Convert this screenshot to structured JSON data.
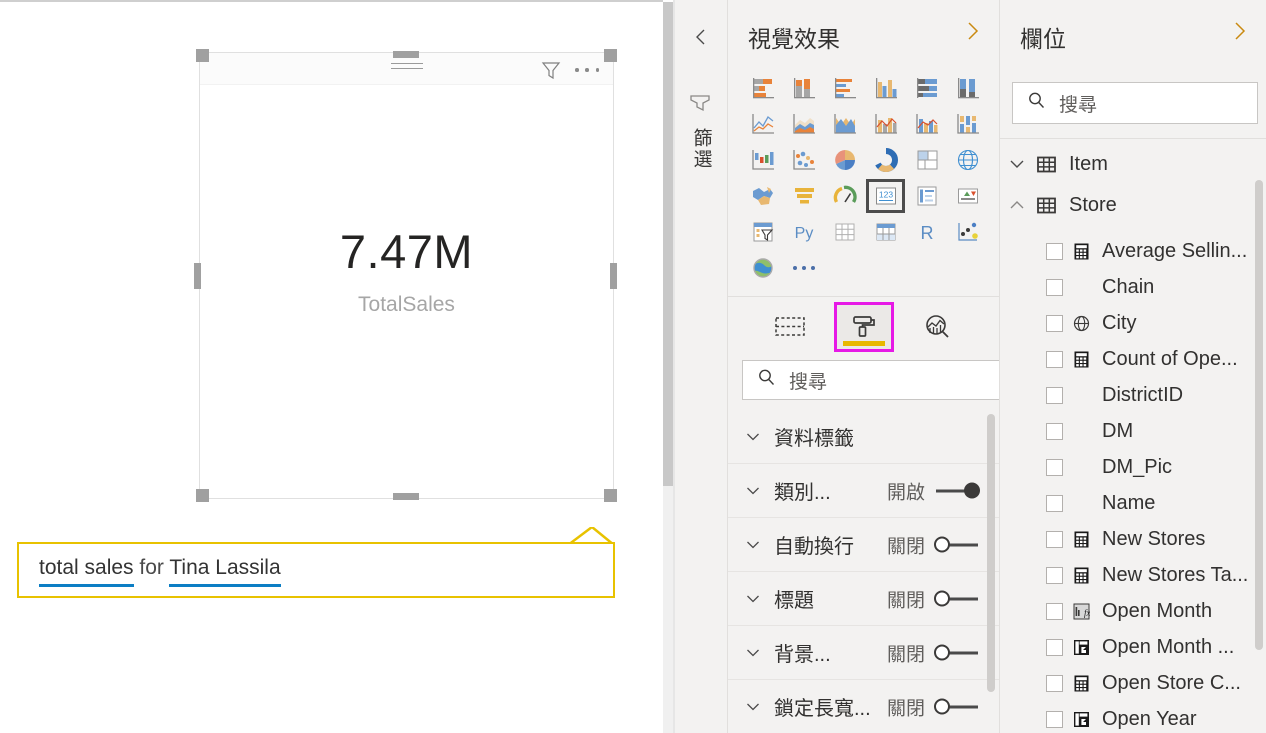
{
  "canvas": {
    "card_visual": {
      "value": "7.47M",
      "label": "TotalSales",
      "header_icons": [
        "drag-handle",
        "filter-icon",
        "more-options-icon"
      ]
    },
    "qna": {
      "tokens": [
        {
          "text": "total sales",
          "highlighted": true
        },
        {
          "text": " for ",
          "highlighted": false
        },
        {
          "text": "Tina Lassila",
          "highlighted": true
        }
      ],
      "full_text": "total sales for Tina Lassila",
      "border_color": "#e8c200",
      "underline_color": "#0c7ec4"
    }
  },
  "filter_rail": {
    "label": "篩選",
    "collapse_icon": "chevron-left-icon",
    "funnel_icon": "funnel-icon"
  },
  "visualizations": {
    "title": "視覺效果",
    "expand_icon": "chevron-right-icon",
    "icons": [
      "stacked-bar-chart",
      "stacked-column-chart",
      "clustered-bar-chart",
      "clustered-column-chart",
      "100-stacked-bar-chart",
      "100-stacked-column-chart",
      "line-chart",
      "area-chart",
      "stacked-area-chart",
      "line-stacked-column-chart",
      "line-clustered-column-chart",
      "ribbon-chart",
      "waterfall-chart",
      "scatter-chart",
      "pie-chart",
      "donut-chart",
      "treemap",
      "map",
      "filled-map",
      "funnel-chart",
      "gauge-chart",
      "card",
      "multi-row-card",
      "kpi",
      "slicer",
      "python-visual",
      "table",
      "matrix",
      "r-visual",
      "key-influencers",
      "arcgis-map",
      "more-visuals"
    ],
    "selected_icon": "card",
    "format_tabs": [
      {
        "name": "fields-tab",
        "icon": "fields-dashed-icon",
        "active": false
      },
      {
        "name": "format-tab",
        "icon": "paint-roller-icon",
        "active": true
      },
      {
        "name": "analytics-tab",
        "icon": "magnifier-chart-icon",
        "active": false
      }
    ],
    "highlight_color": "#e619e6",
    "active_underline_color": "#e8b800",
    "search": {
      "placeholder": "搜尋",
      "icon": "search-icon"
    },
    "properties": [
      {
        "name": "資料標籤",
        "state": null,
        "toggle": null
      },
      {
        "name": "類別...",
        "state": "開啟",
        "toggle": "on"
      },
      {
        "name": "自動換行",
        "state": "關閉",
        "toggle": "off"
      },
      {
        "name": "標題",
        "state": "關閉",
        "toggle": "off"
      },
      {
        "name": "背景...",
        "state": "關閉",
        "toggle": "off"
      },
      {
        "name": "鎖定長寬...",
        "state": "關閉",
        "toggle": "off"
      }
    ]
  },
  "fields": {
    "title": "欄位",
    "expand_icon": "chevron-right-icon",
    "search": {
      "placeholder": "搜尋",
      "icon": "search-icon"
    },
    "tables": [
      {
        "name": "Item",
        "expanded": false,
        "icon": "table-icon"
      },
      {
        "name": "Store",
        "expanded": true,
        "icon": "table-icon"
      }
    ],
    "items": [
      {
        "name": "Average Sellin...",
        "icon": "measure-calculator-icon",
        "checked": false
      },
      {
        "name": "Chain",
        "icon": null,
        "checked": false
      },
      {
        "name": "City",
        "icon": "globe-icon",
        "checked": false
      },
      {
        "name": "Count of Ope...",
        "icon": "measure-calculator-icon",
        "checked": false
      },
      {
        "name": "DistrictID",
        "icon": null,
        "checked": false
      },
      {
        "name": "DM",
        "icon": null,
        "checked": false
      },
      {
        "name": "DM_Pic",
        "icon": null,
        "checked": false
      },
      {
        "name": "Name",
        "icon": null,
        "checked": false
      },
      {
        "name": "New Stores",
        "icon": "measure-calculator-icon",
        "checked": false
      },
      {
        "name": "New Stores Ta...",
        "icon": "measure-calculator-icon",
        "checked": false
      },
      {
        "name": "Open Month",
        "icon": "calculated-column-fx-icon",
        "checked": false
      },
      {
        "name": "Open Month ...",
        "icon": "calculated-column-icon",
        "checked": false
      },
      {
        "name": "Open Store C...",
        "icon": "measure-calculator-icon",
        "checked": false
      },
      {
        "name": "Open Year",
        "icon": "calculated-column-icon",
        "checked": false
      }
    ]
  }
}
